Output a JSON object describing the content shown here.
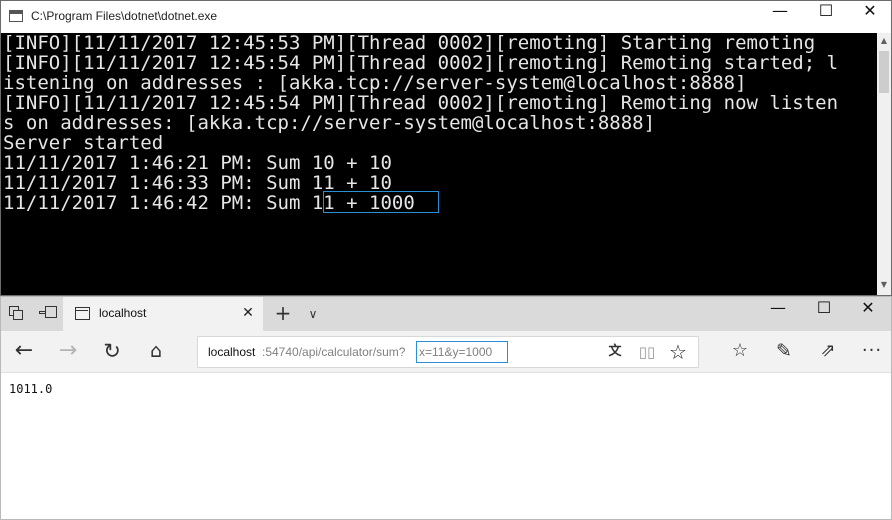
{
  "console": {
    "title": "C:\\Program Files\\dotnet\\dotnet.exe",
    "lines": [
      "[INFO][11/11/2017 12:45:53 PM][Thread 0002][remoting] Starting remoting",
      "[INFO][11/11/2017 12:45:54 PM][Thread 0002][remoting] Remoting started; l",
      "istening on addresses : [akka.tcp://server-system@localhost:8888]",
      "[INFO][11/11/2017 12:45:54 PM][Thread 0002][remoting] Remoting now listen",
      "s on addresses: [akka.tcp://server-system@localhost:8888]",
      "Server started",
      "11/11/2017 1:46:21 PM: Sum 10 + 10",
      "11/11/2017 1:46:33 PM: Sum 11 + 10",
      "11/11/2017 1:46:42 PM: Sum 11 + 1000"
    ],
    "icons": {
      "minimize": "minimize-icon",
      "maximize": "maximize-icon",
      "close": "close-icon",
      "scroll_up": "scroll-up-arrow",
      "scroll_down": "scroll-down-arrow"
    }
  },
  "browser": {
    "tab": {
      "title": "localhost"
    },
    "address": {
      "host": "localhost",
      "path": ":54740/api/calculator/sum?",
      "query": "x=11&y=1000"
    },
    "page": {
      "text": "1011.0"
    },
    "icons": {
      "back": "back-arrow-icon",
      "forward": "forward-arrow-icon",
      "refresh": "refresh-icon",
      "home": "home-icon",
      "translate": "translate-icon",
      "reading_view": "reading-view-icon",
      "favorite": "star-icon",
      "favorites_hub": "favorites-hub-icon",
      "notes": "pen-icon",
      "share": "share-icon",
      "more": "more-icon"
    }
  }
}
